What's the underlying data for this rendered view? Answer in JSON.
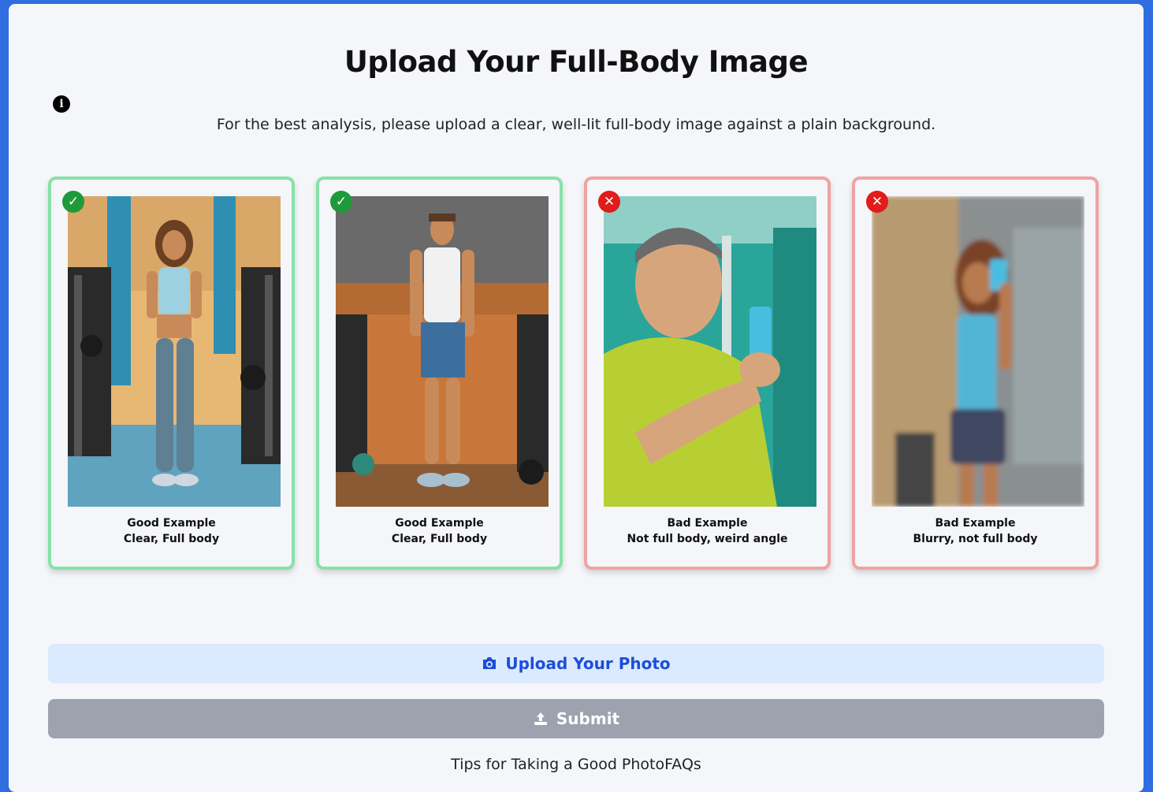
{
  "page": {
    "title": "Upload Your Full-Body Image",
    "subtitle": "For the best analysis, please upload a clear, well-lit full-body image against a plain background."
  },
  "examples": [
    {
      "status": "good",
      "badge_icon": "check-icon",
      "label": "Good Example",
      "description": "Clear, Full body",
      "accent": "#86e2a7"
    },
    {
      "status": "good",
      "badge_icon": "check-icon",
      "label": "Good Example",
      "description": "Clear, Full body",
      "accent": "#86e2a7"
    },
    {
      "status": "bad",
      "badge_icon": "x-icon",
      "label": "Bad Example",
      "description": "Not full body, weird angle",
      "accent": "#f0a2a2"
    },
    {
      "status": "bad",
      "badge_icon": "x-icon",
      "label": "Bad Example",
      "description": "Blurry, not full body",
      "accent": "#f0a2a2"
    }
  ],
  "actions": {
    "upload_label": "Upload Your Photo",
    "upload_icon": "camera-icon",
    "submit_label": "Submit",
    "submit_icon": "upload-icon"
  },
  "footer": {
    "tips_link": "Tips for Taking a Good Photo",
    "faq_link": "FAQs"
  },
  "colors": {
    "frame": "#2f6de1",
    "background": "#f4f6f9",
    "good_badge": "#1e9a3a",
    "bad_badge": "#e21b1b",
    "upload_bg": "#dbeafe",
    "upload_text": "#1d4ed8",
    "submit_bg": "#9ca3af"
  }
}
